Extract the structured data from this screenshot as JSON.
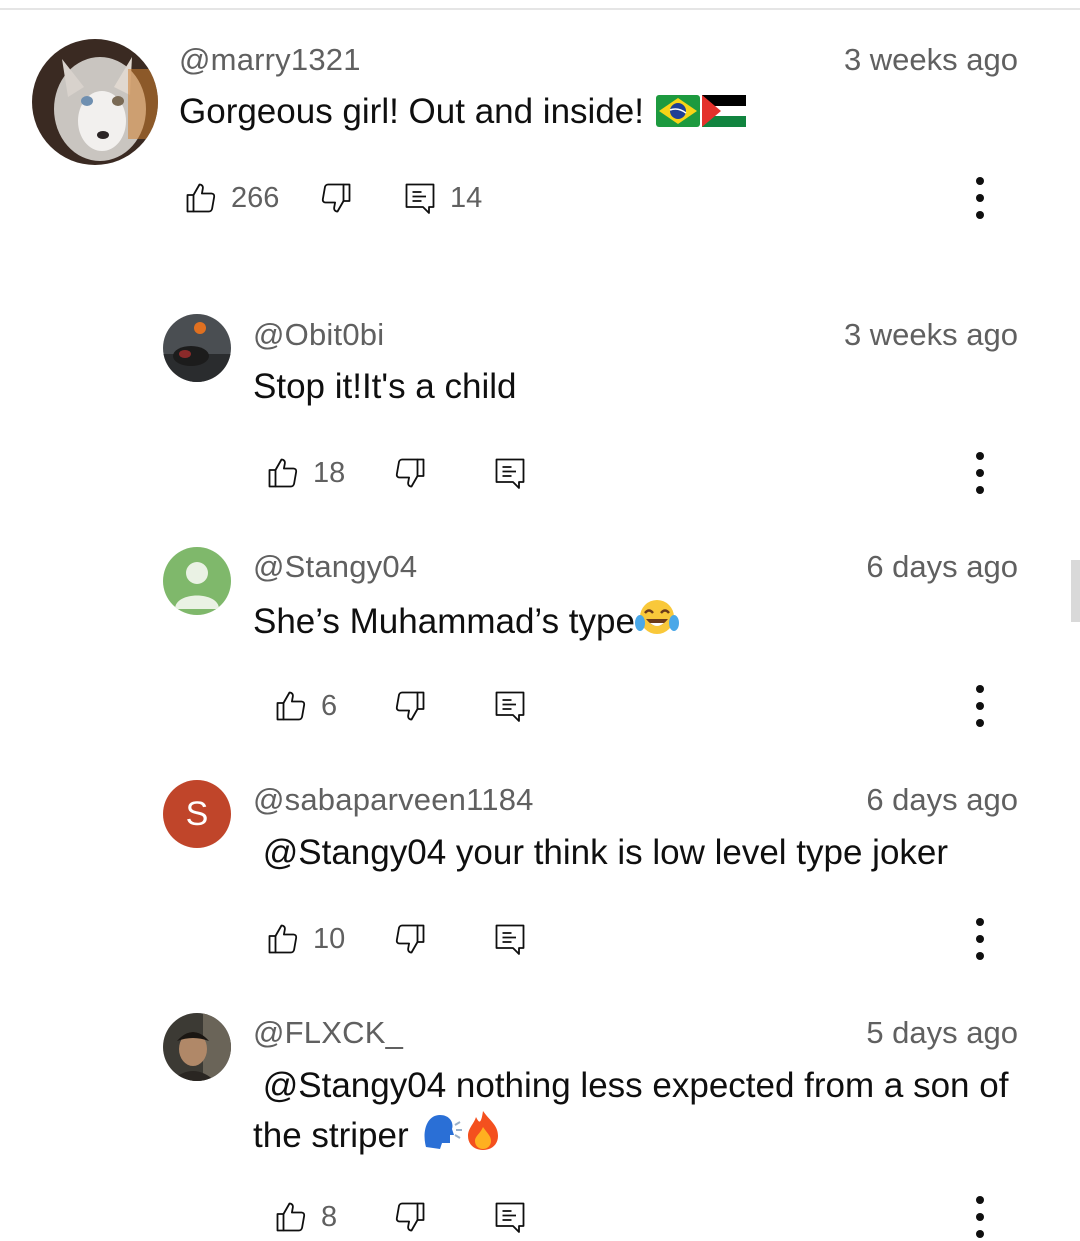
{
  "comments": [
    {
      "author": "@marry1321",
      "time": "3 weeks ago",
      "text": "Gorgeous girl! Out and inside! ",
      "likes": "266",
      "replies": "14",
      "avatar": "husky"
    },
    {
      "author": "@Obit0bi",
      "time": "3 weeks ago",
      "text": "Stop it!It's a child",
      "likes": "18",
      "replies": "",
      "avatar": "photo-dark"
    },
    {
      "author": "@Stangy04",
      "time": "6 days ago",
      "text": "She’s Muhammad’s type",
      "likes": "6",
      "replies": "",
      "avatar": "default-person"
    },
    {
      "author": "@sabaparveen1184",
      "time": "6 days ago",
      "text": " @Stangy04 your think is low level type joker",
      "likes": "10",
      "replies": "",
      "avatar": "letter",
      "avatar_letter": "S"
    },
    {
      "author": "@FLXCK_",
      "time": "5 days ago",
      "text": " @Stangy04 nothing less expected from a son of the striper ",
      "likes": "8",
      "replies": "",
      "avatar": "photo-face"
    }
  ],
  "icons": {
    "like": "thumb-up-icon",
    "dislike": "thumb-down-icon",
    "reply": "comment-reply-icon",
    "more": "more-vert-icon",
    "emoji": [
      "brazil-flag-emoji",
      "palestine-flag-emoji",
      "tears-of-joy-emoji",
      "speaking-head-emoji",
      "fire-emoji"
    ]
  },
  "colors": {
    "text": "#0f0f0f",
    "secondary": "#606060",
    "letter_avatar": "#c0452a",
    "default_avatar": "#7fb86b"
  }
}
